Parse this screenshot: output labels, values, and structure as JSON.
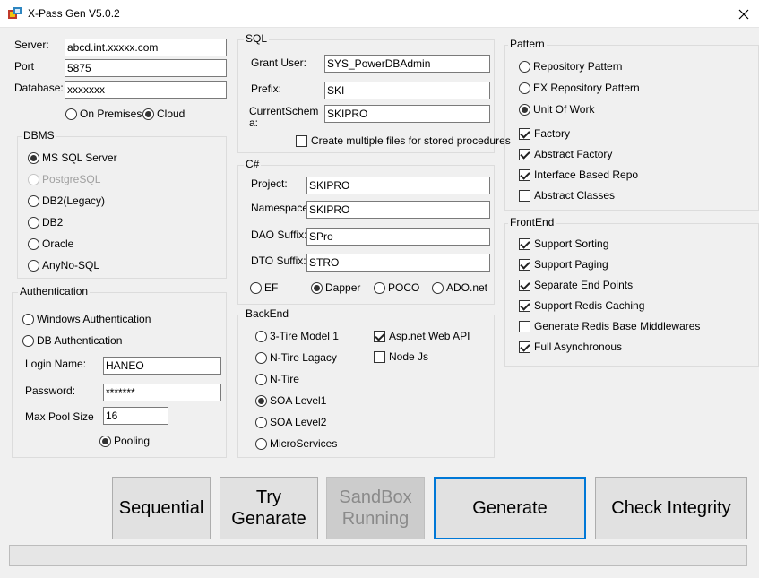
{
  "window": {
    "title": "X-Pass Gen V5.0.2"
  },
  "connection": {
    "server_label": "Server:",
    "server_value": "abcd.int.xxxxx.com",
    "port_label": "Port",
    "port_value": "5875",
    "database_label": "Database:",
    "database_value": "xxxxxxx",
    "on_premises": "On Premises",
    "cloud": "Cloud"
  },
  "dbms": {
    "title": "DBMS",
    "options": [
      {
        "label": "MS SQL Server",
        "selected": true,
        "enabled": true
      },
      {
        "label": "PostgreSQL",
        "selected": false,
        "enabled": false
      },
      {
        "label": "DB2(Legacy)",
        "selected": false,
        "enabled": true
      },
      {
        "label": "DB2",
        "selected": false,
        "enabled": true
      },
      {
        "label": "Oracle",
        "selected": false,
        "enabled": true
      },
      {
        "label": "AnyNo-SQL",
        "selected": false,
        "enabled": true
      }
    ]
  },
  "auth": {
    "title": "Authentication",
    "windows": "Windows Authentication",
    "db": "DB Authentication",
    "login_label": "Login Name:",
    "login_value": "HANEO",
    "password_label": "Password:",
    "password_value": "*******",
    "pool_label": "Max Pool Size",
    "pool_value": "16",
    "pooling": "Pooling"
  },
  "sql": {
    "title": "SQL",
    "grant_label": "Grant User:",
    "grant_value": "SYS_PowerDBAdmin",
    "prefix_label": "Prefix:",
    "prefix_value": "SKI",
    "schema_label_1": "CurrentSchem",
    "schema_label_2": "a:",
    "schema_value": "SKIPRO",
    "multi_files": "Create multiple files for stored procedures"
  },
  "csharp": {
    "title": "C#",
    "project_label": "Project:",
    "project_value": "SKIPRO",
    "namespace_label": "Namespace:",
    "namespace_value": "SKIPRO",
    "dao_label": "DAO Suffix:",
    "dao_value": "SPro",
    "dto_label": "DTO Suffix:",
    "dto_value": "STRO",
    "orm": [
      {
        "label": "EF",
        "selected": false
      },
      {
        "label": "Dapper",
        "selected": true
      },
      {
        "label": "POCO",
        "selected": false
      },
      {
        "label": "ADO.net",
        "selected": false
      }
    ]
  },
  "backend": {
    "title": "BackEnd",
    "options": [
      {
        "label": "3-Tire Model 1",
        "selected": false
      },
      {
        "label": "N-Tire Lagacy",
        "selected": false
      },
      {
        "label": "N-Tire",
        "selected": false
      },
      {
        "label": "SOA Level1",
        "selected": true
      },
      {
        "label": "SOA Level2",
        "selected": false
      },
      {
        "label": "MicroServices",
        "selected": false
      }
    ],
    "checks": [
      {
        "label": "Asp.net Web API",
        "checked": true
      },
      {
        "label": "Node Js",
        "checked": false
      }
    ]
  },
  "pattern": {
    "title": "Pattern",
    "radios": [
      {
        "label": "Repository Pattern",
        "selected": false
      },
      {
        "label": "EX Repository Pattern",
        "selected": false
      },
      {
        "label": "Unit Of Work",
        "selected": true
      }
    ],
    "checks": [
      {
        "label": "Factory",
        "checked": true
      },
      {
        "label": "Abstract Factory",
        "checked": true
      },
      {
        "label": "Interface Based Repo",
        "checked": true
      },
      {
        "label": "Abstract Classes",
        "checked": false
      }
    ]
  },
  "frontend": {
    "title": "FrontEnd",
    "checks": [
      {
        "label": "Support Sorting",
        "checked": true
      },
      {
        "label": "Support Paging",
        "checked": true
      },
      {
        "label": "Separate End Points",
        "checked": true
      },
      {
        "label": "Support Redis Caching",
        "checked": true
      },
      {
        "label": "Generate Redis Base Middlewares",
        "checked": false
      },
      {
        "label": "Full Asynchronous",
        "checked": true
      }
    ]
  },
  "actions": {
    "sequential": "Sequential",
    "try_generate": "Try\nGenarate",
    "sandbox": "SandBox\nRunning",
    "generate": "Generate",
    "check_integrity": "Check Integrity"
  },
  "progress": {
    "value": 0
  }
}
